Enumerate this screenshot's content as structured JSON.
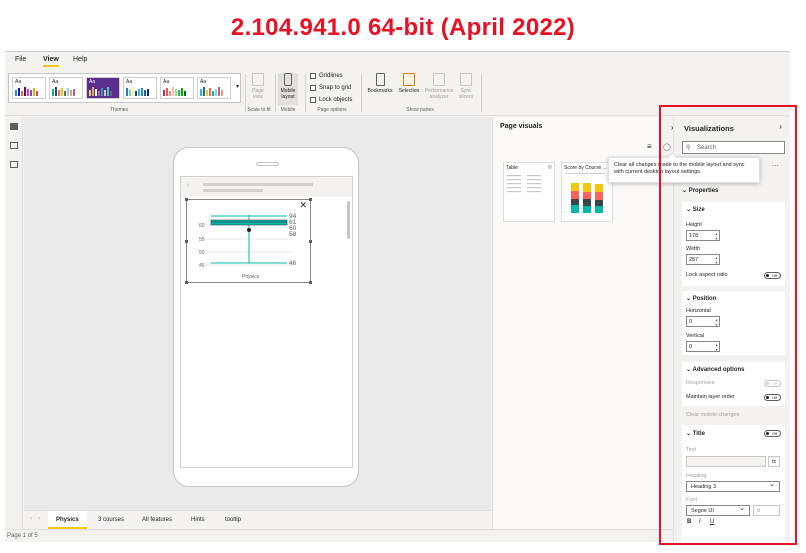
{
  "banner": {
    "title": "2.104.941.0 64-bit (April 2022)"
  },
  "menu": {
    "file": "File",
    "view": "View",
    "help": "Help"
  },
  "ribbon": {
    "themes_label": "Themes",
    "scale_label": "Scale to fit",
    "mobile_label": "Mobile",
    "page_options_label": "Page options",
    "show_panes_label": "Show panes",
    "page_view": "Page view",
    "mobile_layout": "Mobile layout",
    "gridlines": "Gridlines",
    "snap_to_grid": "Snap to grid",
    "lock_objects": "Lock objects",
    "bookmarks": "Bookmarks",
    "selection": "Selection",
    "performance": "Performance analyzer",
    "sync_slicers": "Sync slicers",
    "theme_aa": "Aa"
  },
  "chart": {
    "y_ticks": [
      "60",
      "55",
      "50",
      "45"
    ],
    "values": [
      "94",
      "61",
      "60",
      "58",
      "46"
    ],
    "category": "Physics"
  },
  "tabs": [
    "Physics",
    "3 courses",
    "All features",
    "Hints",
    "tooltip"
  ],
  "status": {
    "page": "Page 1 of 5"
  },
  "page_visuals": {
    "title": "Page visuals",
    "card1": "Table",
    "card2": "Score by Course ..."
  },
  "tooltip": {
    "text": "Clear all changes made to the mobile layout and sync with current desktop layout settings."
  },
  "viz": {
    "title": "Visualizations",
    "search_placeholder": "Search",
    "more": "...",
    "properties": "Properties",
    "size": "Size",
    "height_label": "Height",
    "height_value": "178",
    "width_label": "Width",
    "width_value": "257",
    "lock_aspect": "Lock aspect ratio",
    "position": "Position",
    "horizontal_label": "Horizontal",
    "horizontal_value": "0",
    "vertical_label": "Vertical",
    "vertical_value": "0",
    "advanced": "Advanced options",
    "responsive": "Responsive",
    "maintain_layer": "Maintain layer order",
    "clear_mobile": "Clear mobile changes",
    "title_section": "Title",
    "text_label": "Text",
    "heading_label": "Heading",
    "heading_value": "Heading 3",
    "font_label": "Font",
    "font_value": "Segoe UI",
    "font_size": "9",
    "fx": "fx",
    "bold": "B",
    "italic": "I",
    "underline": "U",
    "toggle_off": "Off"
  },
  "colors": {
    "accent": "#f2c811",
    "highlight": "#e81123",
    "teal": "#01b8aa",
    "dark": "#374649",
    "red": "#fd625e",
    "yellow": "#f2c80f"
  }
}
